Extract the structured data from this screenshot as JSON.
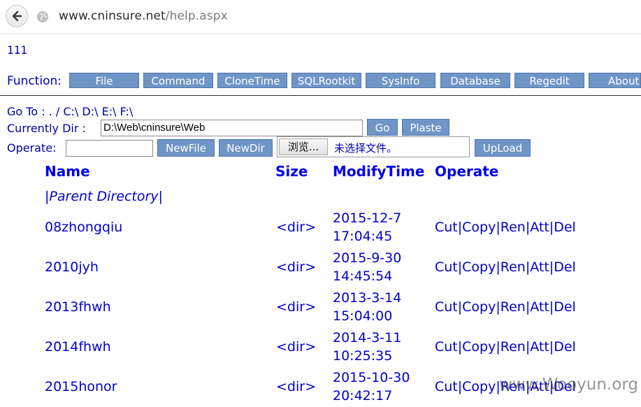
{
  "browser": {
    "url_host": "www.cninsure.net",
    "url_path": "/help.aspx"
  },
  "header": {
    "title": "111"
  },
  "function_bar": {
    "label": "Function:",
    "buttons": [
      "File",
      "Command",
      "CloneTime",
      "SQLRootkit",
      "SysInfo",
      "Database",
      "Regedit",
      "About"
    ]
  },
  "goto": {
    "label": "Go To :",
    "links": [
      ". /",
      "C:\\",
      "D:\\",
      "E:\\",
      "F:\\"
    ]
  },
  "current_dir": {
    "label": "Currently Dir :",
    "value": "D:\\Web\\cninsure\\Web",
    "go_label": "Go",
    "paste_label": "Plaste"
  },
  "operate": {
    "label": "Operate:",
    "input_value": "",
    "newfile_label": "NewFile",
    "newdir_label": "NewDir",
    "browse_label": "浏览...",
    "file_status": "未选择文件。",
    "upload_label": "UpLoad"
  },
  "table": {
    "headers": {
      "name": "Name",
      "size": "Size",
      "time": "ModifyTime",
      "operate": "Operate"
    },
    "parent_link": "|Parent Directory|",
    "rows": [
      {
        "name": "08zhongqiu",
        "size": "<dir>",
        "date": "2015-12-7",
        "time": "17:04:45",
        "ops": "Cut|Copy|Ren|Att|Del"
      },
      {
        "name": "2010jyh",
        "size": "<dir>",
        "date": "2015-9-30",
        "time": "14:45:54",
        "ops": "Cut|Copy|Ren|Att|Del"
      },
      {
        "name": "2013fhwh",
        "size": "<dir>",
        "date": "2013-3-14",
        "time": "15:04:00",
        "ops": "Cut|Copy|Ren|Att|Del"
      },
      {
        "name": "2014fhwh",
        "size": "<dir>",
        "date": "2014-3-11",
        "time": "10:25:35",
        "ops": "Cut|Copy|Ren|Att|Del"
      },
      {
        "name": "2015honor",
        "size": "<dir>",
        "date": "2015-10-30",
        "time": "20:42:17",
        "ops": "Cut|Copy|Ren|Att|Del"
      }
    ]
  },
  "watermark": "www.Wooyun.org",
  "colors": {
    "text": "#0000aa",
    "link": "#0000cc",
    "button_bg": "#6f95c6",
    "button_border": "#4f77ad"
  }
}
